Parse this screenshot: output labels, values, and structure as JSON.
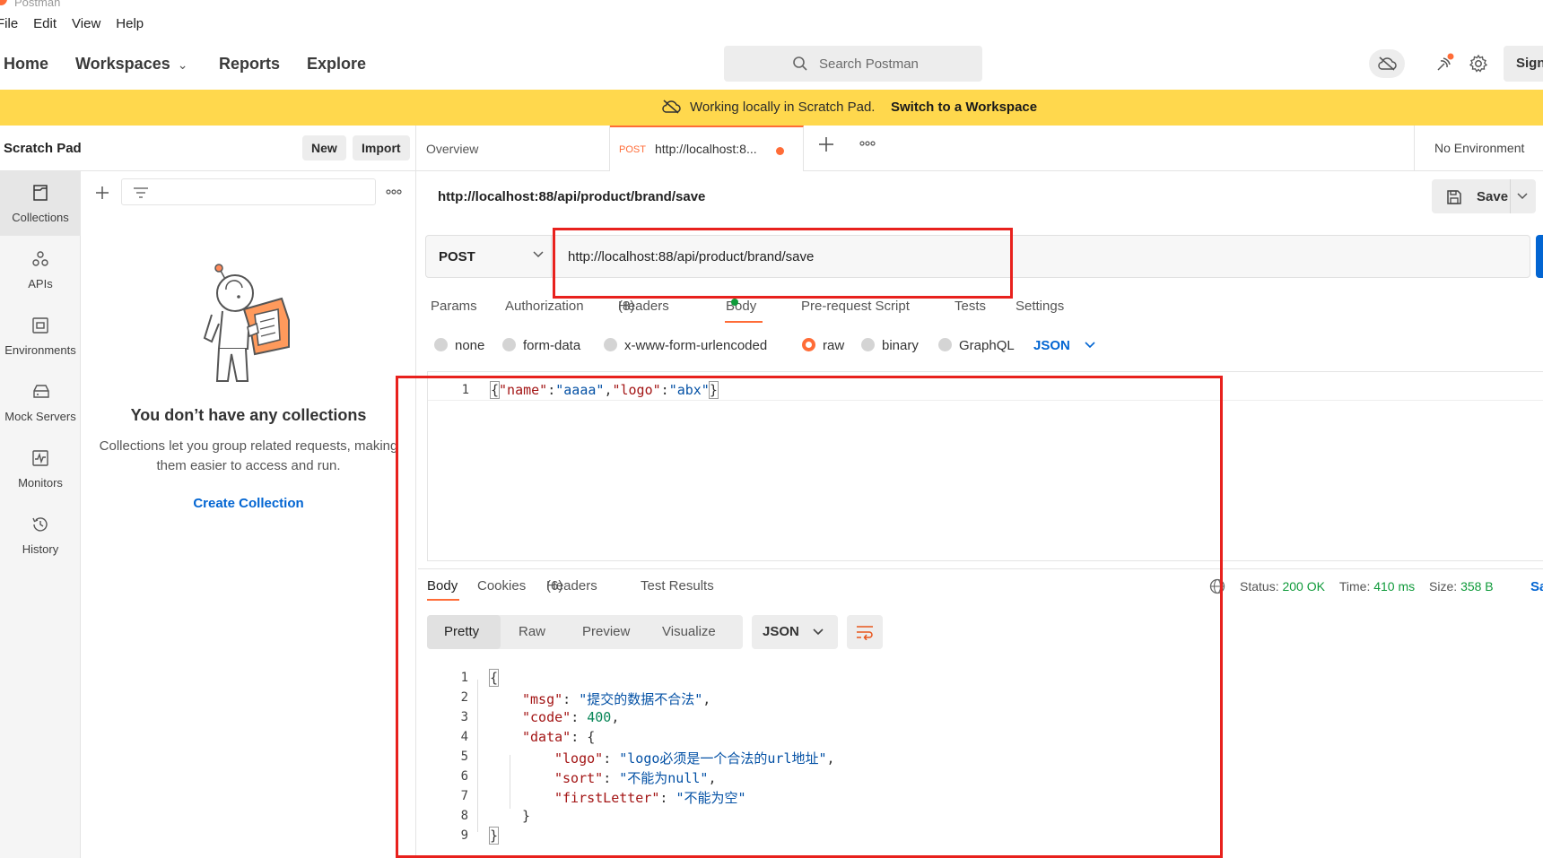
{
  "app": {
    "name": "Postman"
  },
  "menu": [
    "File",
    "Edit",
    "View",
    "Help"
  ],
  "nav": {
    "home": "Home",
    "workspaces": "Workspaces",
    "reports": "Reports",
    "explore": "Explore"
  },
  "search": {
    "placeholder": "Search Postman"
  },
  "signin_label": "Sign I",
  "banner": {
    "text": "Working locally in Scratch Pad.",
    "link": "Switch to a Workspace",
    "color": "#ffd84d"
  },
  "sidebar": {
    "title": "Scratch Pad",
    "new_label": "New",
    "import_label": "Import",
    "rail": [
      {
        "icon": "collections-icon",
        "label": "Collections"
      },
      {
        "icon": "apis-icon",
        "label": "APIs"
      },
      {
        "icon": "environments-icon",
        "label": "Environments"
      },
      {
        "icon": "mock-servers-icon",
        "label": "Mock Servers"
      },
      {
        "icon": "monitors-icon",
        "label": "Monitors"
      },
      {
        "icon": "history-icon",
        "label": "History"
      }
    ],
    "empty_title": "You don’t have any collections",
    "empty_desc": "Collections let you group related requests, making them easier to access and run.",
    "create_link": "Create Collection"
  },
  "tabs": {
    "overview": "Overview",
    "active_method": "POST",
    "active_url": "http://localhost:8...",
    "environment": "No Environment"
  },
  "request": {
    "title": "http://localhost:88/api/product/brand/save",
    "save_label": "Save",
    "method": "POST",
    "url": "http://localhost:88/api/product/brand/save",
    "tabs": [
      {
        "label": "Params"
      },
      {
        "label": "Authorization"
      },
      {
        "label": "Headers",
        "count": "(8)"
      },
      {
        "label": "Body"
      },
      {
        "label": "Pre-request Script"
      },
      {
        "label": "Tests"
      },
      {
        "label": "Settings"
      }
    ],
    "body_modes": [
      "none",
      "form-data",
      "x-www-form-urlencoded",
      "raw",
      "binary",
      "GraphQL"
    ],
    "selected_mode": "raw",
    "format": "JSON",
    "body_line_no": "1",
    "body_parts": [
      "{",
      "\"name\"",
      ":",
      "\"aaaa\"",
      ",",
      "\"logo\"",
      ":",
      "\"abx\"",
      "}"
    ]
  },
  "response": {
    "tabs": [
      {
        "label": "Body"
      },
      {
        "label": "Cookies"
      },
      {
        "label": "Headers",
        "count": "(6)"
      },
      {
        "label": "Test Results"
      }
    ],
    "status_label": "Status:",
    "status_value": "200 OK",
    "time_label": "Time:",
    "time_value": "410 ms",
    "size_label": "Size:",
    "size_value": "358 B",
    "save_partial": "Sa",
    "views": [
      "Pretty",
      "Raw",
      "Preview",
      "Visualize"
    ],
    "format": "JSON",
    "line_numbers": [
      "1",
      "2",
      "3",
      "4",
      "5",
      "6",
      "7",
      "8",
      "9"
    ],
    "lines": {
      "l1": "{",
      "l2_key": "\"msg\"",
      "l2_val": "\"提交的数据不合法\"",
      "l3_key": "\"code\"",
      "l3_val": "400",
      "l4_key": "\"data\"",
      "l4_open": "{",
      "l5_key": "\"logo\"",
      "l5_val": "\"logo必须是一个合法的url地址\"",
      "l6_key": "\"sort\"",
      "l6_val": "\"不能为null\"",
      "l7_key": "\"firstLetter\"",
      "l7_val": "\"不能为空\"",
      "l8": "}",
      "l9": "}"
    }
  },
  "colors": {
    "accent": "#ff6c37",
    "link": "#0265d2",
    "success": "#0f9a3a",
    "annotation": "#e8211d"
  }
}
